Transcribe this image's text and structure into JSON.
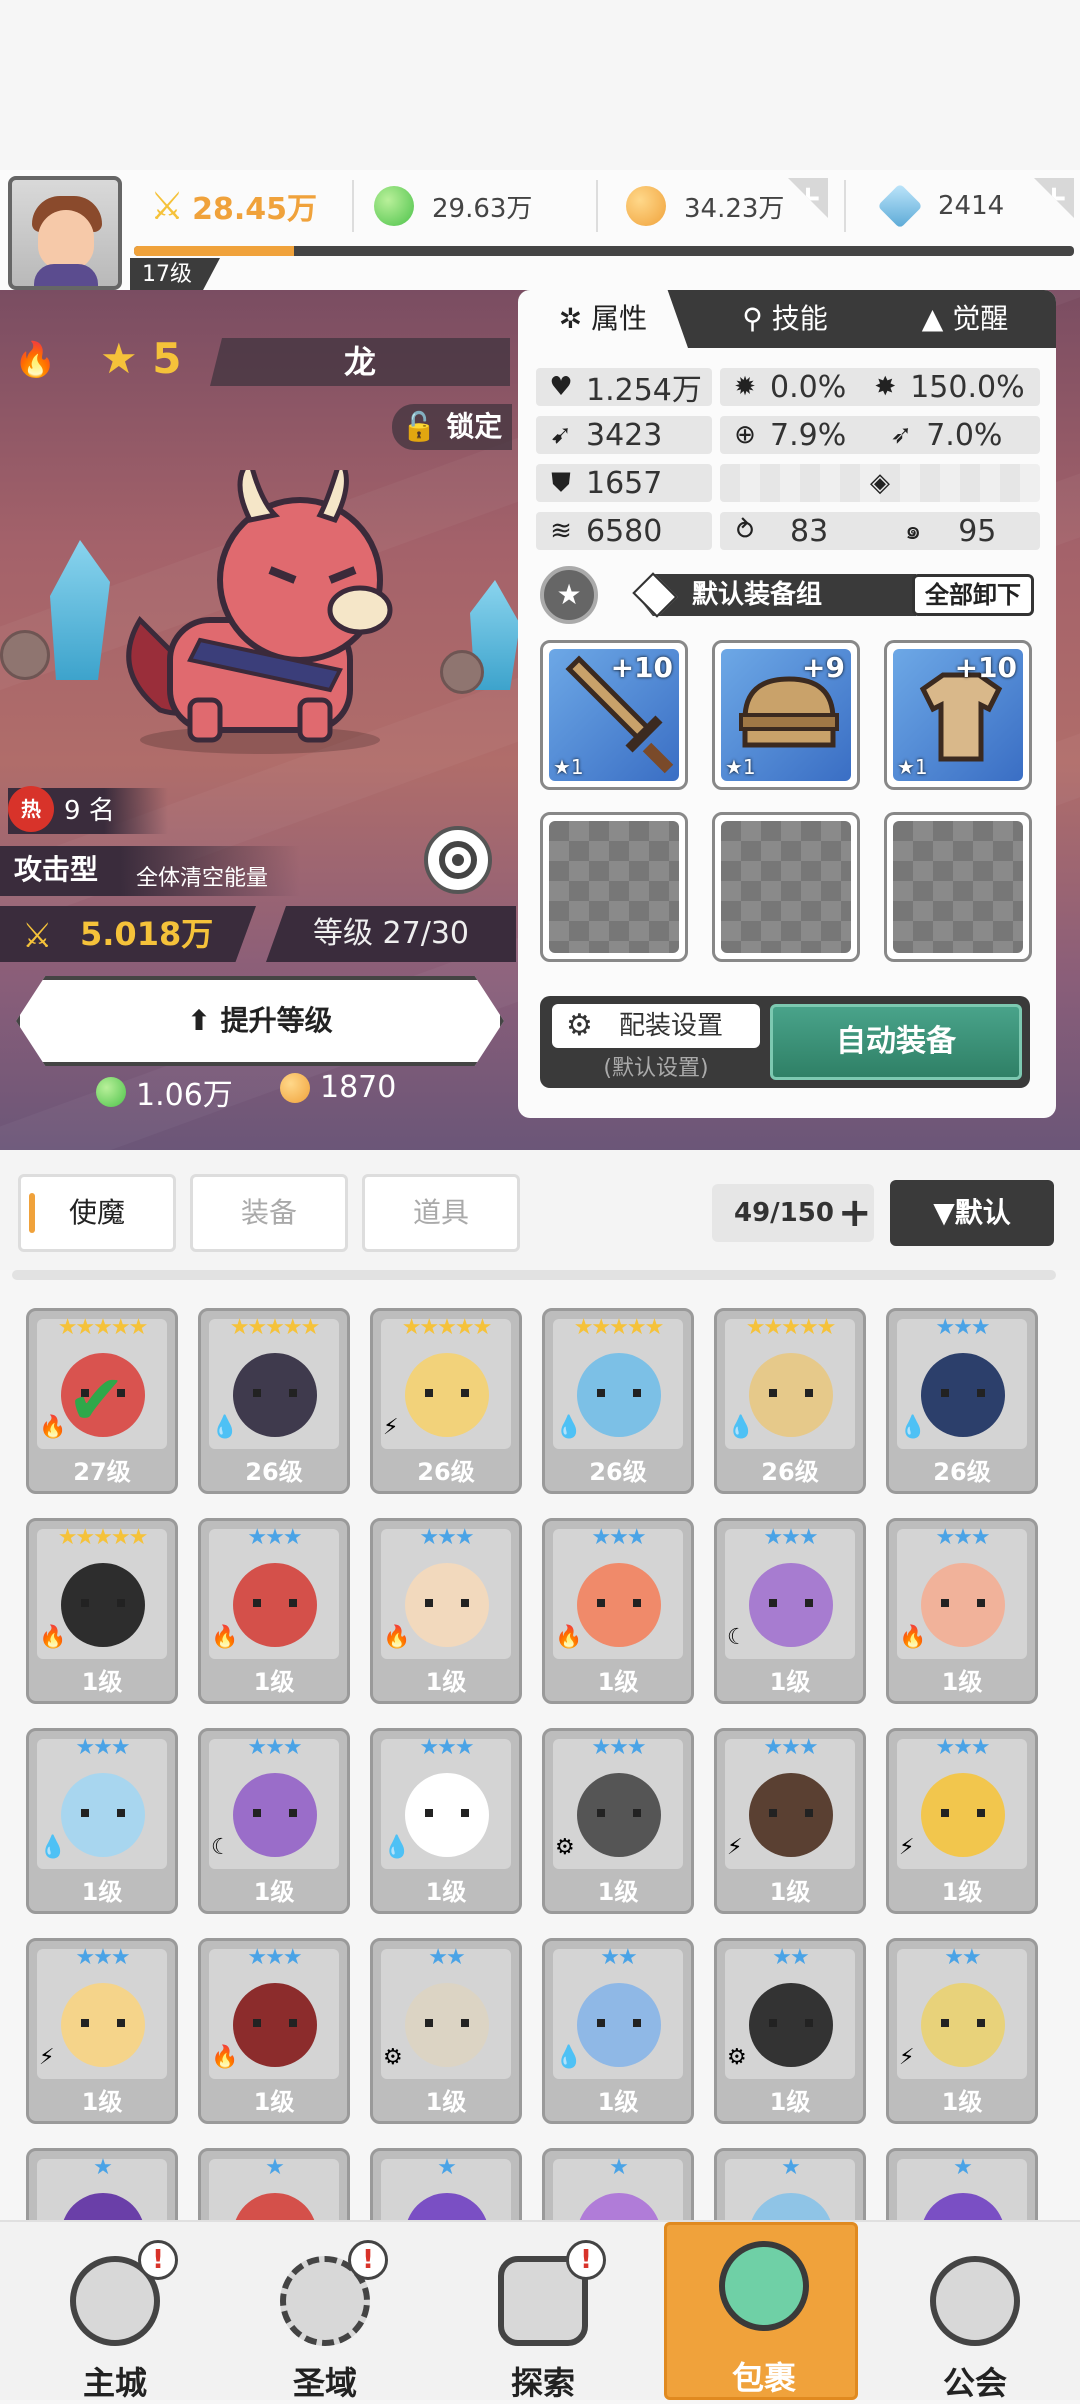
{
  "header": {
    "player_level": "17级",
    "resources": {
      "power": "28.45万",
      "green_gem": "29.63万",
      "gold": "34.23万",
      "diamond": "2414"
    },
    "xp_fraction": 0.17
  },
  "hero": {
    "element_icon": "fire-icon",
    "star": "5",
    "name": "龙",
    "lock_label": "锁定",
    "rank_badge": "热",
    "rank_text": "9 名",
    "type": "攻击型",
    "skill_desc": "全体清空能量",
    "power": "5.018万",
    "level": "等级 27/30",
    "upgrade_label": "提升等级",
    "cost_green": "1.06万",
    "cost_gold": "1870"
  },
  "panel": {
    "tabs": [
      "属性",
      "技能",
      "觉醒"
    ],
    "stats": {
      "hp": "1.254万",
      "crit": "0.0%",
      "crit_dmg": "150.0%",
      "atk": "3423",
      "accuracy": "7.9%",
      "dodge": "7.0%",
      "def": "1657",
      "speed": "6580",
      "stat_a": "83",
      "stat_b": "95"
    },
    "equip_group": "默认装备组",
    "unequip_all": "全部卸下",
    "equipment": [
      {
        "name": "sword",
        "plus": "+10",
        "star": "★1"
      },
      {
        "name": "helmet",
        "plus": "+9",
        "star": "★1"
      },
      {
        "name": "armor",
        "plus": "+10",
        "star": "★1"
      }
    ],
    "config_label": "配装设置",
    "config_sub": "(默认设置)",
    "auto_equip": "自动装备"
  },
  "filter": {
    "tabs": [
      "使魔",
      "装备",
      "道具"
    ],
    "count": "49/150",
    "sort": "▼默认"
  },
  "cards": [
    {
      "stars": "★★★★★",
      "lvl": "27级",
      "elem": "🔥",
      "color": "#d9534f",
      "selected": true
    },
    {
      "stars": "★★★★★",
      "lvl": "26级",
      "elem": "💧",
      "color": "#3f3a4d"
    },
    {
      "stars": "★★★★★",
      "lvl": "26级",
      "elem": "⚡",
      "color": "#f2d27a"
    },
    {
      "stars": "★★★★★",
      "lvl": "26级",
      "elem": "💧",
      "color": "#7cc0e6"
    },
    {
      "stars": "★★★★★",
      "lvl": "26级",
      "elem": "💧",
      "color": "#e6c98a"
    },
    {
      "stars": "★★★",
      "lvl": "26级",
      "elem": "💧",
      "color": "#2c3f6b"
    },
    {
      "stars": "★★★★★",
      "lvl": "1级",
      "elem": "🔥",
      "color": "#2d2d2d"
    },
    {
      "stars": "★★★",
      "lvl": "1级",
      "elem": "🔥",
      "color": "#d4504a"
    },
    {
      "stars": "★★★",
      "lvl": "1级",
      "elem": "🔥",
      "color": "#f2d9bd"
    },
    {
      "stars": "★★★",
      "lvl": "1级",
      "elem": "🔥",
      "color": "#f08a6a"
    },
    {
      "stars": "★★★",
      "lvl": "1级",
      "elem": "☾",
      "color": "#a77cd0"
    },
    {
      "stars": "★★★",
      "lvl": "1级",
      "elem": "🔥",
      "color": "#f1b29a"
    },
    {
      "stars": "★★★",
      "lvl": "1级",
      "elem": "💧",
      "color": "#a8d6ef"
    },
    {
      "stars": "★★★",
      "lvl": "1级",
      "elem": "☾",
      "color": "#9a6dc9"
    },
    {
      "stars": "★★★",
      "lvl": "1级",
      "elem": "💧",
      "color": "#ffffff"
    },
    {
      "stars": "★★★",
      "lvl": "1级",
      "elem": "⚙",
      "color": "#555555"
    },
    {
      "stars": "★★★",
      "lvl": "1级",
      "elem": "⚡",
      "color": "#5a4032"
    },
    {
      "stars": "★★★",
      "lvl": "1级",
      "elem": "⚡",
      "color": "#f2c64d"
    },
    {
      "stars": "★★★",
      "lvl": "1级",
      "elem": "⚡",
      "color": "#f5d48a"
    },
    {
      "stars": "★★★",
      "lvl": "1级",
      "elem": "🔥",
      "color": "#8c2c2c"
    },
    {
      "stars": "★★",
      "lvl": "1级",
      "elem": "⚙",
      "color": "#dcd4c4"
    },
    {
      "stars": "★★",
      "lvl": "1级",
      "elem": "💧",
      "color": "#8fb8e6"
    },
    {
      "stars": "★★",
      "lvl": "1级",
      "elem": "⚙",
      "color": "#333333"
    },
    {
      "stars": "★★",
      "lvl": "1级",
      "elem": "⚡",
      "color": "#e8d27a"
    },
    {
      "stars": "★",
      "lvl": "",
      "elem": "",
      "color": "#6a3fa8"
    },
    {
      "stars": "★",
      "lvl": "",
      "elem": "",
      "color": "#d4504a"
    },
    {
      "stars": "★",
      "lvl": "",
      "elem": "",
      "color": "#7a4fc4"
    },
    {
      "stars": "★",
      "lvl": "",
      "elem": "",
      "color": "#b07cd8"
    },
    {
      "stars": "★",
      "lvl": "",
      "elem": "",
      "color": "#8fc4e6"
    },
    {
      "stars": "★",
      "lvl": "",
      "elem": "",
      "color": "#7a4fc4"
    }
  ],
  "nav": {
    "items": [
      "主城",
      "圣域",
      "探索",
      "包裹",
      "公会"
    ],
    "badge": "!"
  },
  "colors": {
    "accent": "#f0a23b",
    "dark": "#3a3a3a",
    "green_button": "#2f8066",
    "star_gold": "#f5c23a"
  }
}
